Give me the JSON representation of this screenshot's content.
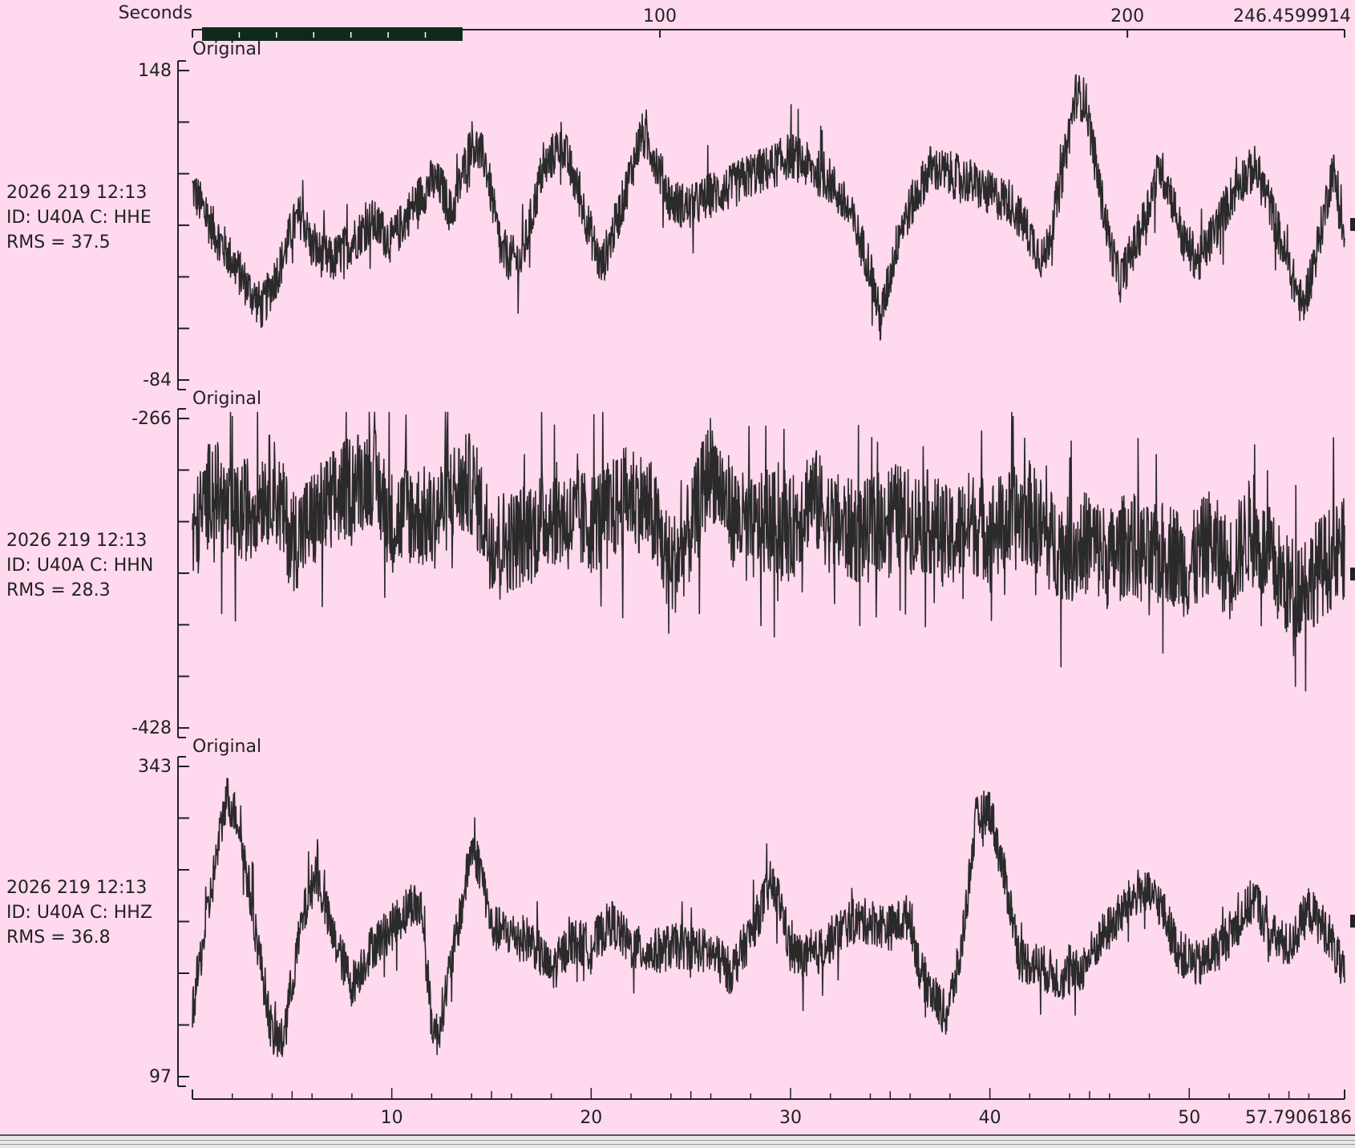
{
  "colors": {
    "background": "#ffd9ee",
    "trace": "#2a2a2a",
    "axis": "#222222",
    "overview_bar": "#0f2a1c",
    "overview_tick": "#ffffff"
  },
  "top_axis": {
    "label": "Seconds",
    "min": 0,
    "max": 246.4599914,
    "max_label": "246.4599914",
    "ticks": [
      {
        "value": 100,
        "label": "100"
      },
      {
        "value": 200,
        "label": "200"
      }
    ],
    "selection": {
      "start": 0,
      "end": 57.7906186
    }
  },
  "bottom_axis": {
    "min": 0,
    "max": 57.7906186,
    "max_label": "57.7906186",
    "ticks": [
      {
        "value": 10,
        "label": "10"
      },
      {
        "value": 20,
        "label": "20"
      },
      {
        "value": 30,
        "label": "30"
      },
      {
        "value": 40,
        "label": "40"
      },
      {
        "value": 50,
        "label": "50"
      }
    ]
  },
  "channels": [
    {
      "tag": "Original",
      "time": "2026 219 12:13",
      "id_line": "ID: U40A C: HHE",
      "rms": "RMS = 37.5",
      "ymax_label": "148",
      "ymin_label": "-84"
    },
    {
      "tag": "Original",
      "time": "2026 219 12:13",
      "id_line": "ID: U40A C: HHN",
      "rms": "RMS = 28.3",
      "ymax_label": "-266",
      "ymin_label": "-428"
    },
    {
      "tag": "Original",
      "time": "2026 219 12:13",
      "id_line": "ID: U40A C: HHZ",
      "rms": "RMS = 36.8",
      "ymax_label": "343",
      "ymin_label": "97"
    }
  ],
  "chart_data": {
    "type": "line",
    "x_unit": "Seconds",
    "x_range": [
      0,
      57.7906186
    ],
    "overview_range": [
      0,
      246.4599914
    ],
    "series": [
      {
        "name": "ID: U40A C: HHE",
        "ylim": [
          -84,
          148
        ],
        "rms": 37.5,
        "envelope": [
          [
            0.0,
            60
          ],
          [
            1.0,
            30
          ],
          [
            2.0,
            5
          ],
          [
            3.0,
            -20
          ],
          [
            3.5,
            -30
          ],
          [
            4.5,
            5
          ],
          [
            5.0,
            30
          ],
          [
            5.5,
            40
          ],
          [
            6.0,
            15
          ],
          [
            7.0,
            5
          ],
          [
            8.0,
            20
          ],
          [
            9.0,
            35
          ],
          [
            10.0,
            20
          ],
          [
            11.0,
            45
          ],
          [
            12.0,
            65
          ],
          [
            12.5,
            60
          ],
          [
            13.0,
            40
          ],
          [
            14.0,
            95
          ],
          [
            14.7,
            80
          ],
          [
            15.5,
            10
          ],
          [
            16.5,
            5
          ],
          [
            17.5,
            70
          ],
          [
            18.5,
            95
          ],
          [
            19.5,
            50
          ],
          [
            20.5,
            0
          ],
          [
            21.5,
            45
          ],
          [
            22.5,
            100
          ],
          [
            23.0,
            90
          ],
          [
            24.0,
            50
          ],
          [
            25.0,
            45
          ],
          [
            26.0,
            55
          ],
          [
            27.0,
            60
          ],
          [
            28.0,
            70
          ],
          [
            29.0,
            75
          ],
          [
            30.0,
            85
          ],
          [
            31.0,
            75
          ],
          [
            32.0,
            65
          ],
          [
            33.0,
            40
          ],
          [
            34.0,
            0
          ],
          [
            34.5,
            -40
          ],
          [
            35.5,
            30
          ],
          [
            37.0,
            75
          ],
          [
            38.0,
            70
          ],
          [
            39.0,
            65
          ],
          [
            40.0,
            55
          ],
          [
            41.0,
            50
          ],
          [
            42.0,
            25
          ],
          [
            42.7,
            5
          ],
          [
            43.5,
            60
          ],
          [
            44.3,
            130
          ],
          [
            44.8,
            125
          ],
          [
            45.5,
            60
          ],
          [
            46.0,
            20
          ],
          [
            46.5,
            -10
          ],
          [
            47.5,
            25
          ],
          [
            48.5,
            75
          ],
          [
            49.0,
            60
          ],
          [
            49.7,
            20
          ],
          [
            50.5,
            5
          ],
          [
            51.5,
            35
          ],
          [
            52.5,
            65
          ],
          [
            53.3,
            75
          ],
          [
            54.0,
            50
          ],
          [
            55.0,
            0
          ],
          [
            55.7,
            -30
          ],
          [
            56.5,
            20
          ],
          [
            57.2,
            75
          ],
          [
            57.79,
            20
          ]
        ]
      },
      {
        "name": "ID: U40A C: HHN",
        "ylim": [
          -428,
          -266
        ],
        "rms": 28.3,
        "envelope": [
          [
            0.0,
            -330
          ],
          [
            1.0,
            -300
          ],
          [
            2.0,
            -320
          ],
          [
            3.0,
            -310
          ],
          [
            4.0,
            -300
          ],
          [
            5.0,
            -330
          ],
          [
            6.0,
            -320
          ],
          [
            7.0,
            -310
          ],
          [
            8.0,
            -300
          ],
          [
            9.0,
            -295
          ],
          [
            10.0,
            -320
          ],
          [
            11.0,
            -315
          ],
          [
            12.0,
            -320
          ],
          [
            13.0,
            -305
          ],
          [
            14.0,
            -300
          ],
          [
            15.0,
            -330
          ],
          [
            16.0,
            -330
          ],
          [
            17.0,
            -325
          ],
          [
            18.0,
            -315
          ],
          [
            19.0,
            -320
          ],
          [
            20.0,
            -320
          ],
          [
            21.0,
            -315
          ],
          [
            22.0,
            -305
          ],
          [
            23.0,
            -315
          ],
          [
            24.0,
            -345
          ],
          [
            25.0,
            -325
          ],
          [
            26.0,
            -290
          ],
          [
            27.0,
            -315
          ],
          [
            28.0,
            -325
          ],
          [
            29.0,
            -320
          ],
          [
            30.0,
            -325
          ],
          [
            31.0,
            -305
          ],
          [
            32.0,
            -320
          ],
          [
            33.0,
            -325
          ],
          [
            34.0,
            -325
          ],
          [
            35.0,
            -315
          ],
          [
            36.0,
            -320
          ],
          [
            37.0,
            -320
          ],
          [
            38.0,
            -330
          ],
          [
            39.0,
            -320
          ],
          [
            40.0,
            -325
          ],
          [
            41.0,
            -320
          ],
          [
            42.0,
            -315
          ],
          [
            43.0,
            -330
          ],
          [
            44.0,
            -335
          ],
          [
            45.0,
            -330
          ],
          [
            46.0,
            -340
          ],
          [
            47.0,
            -330
          ],
          [
            48.0,
            -340
          ],
          [
            49.0,
            -335
          ],
          [
            50.0,
            -345
          ],
          [
            51.0,
            -330
          ],
          [
            52.0,
            -345
          ],
          [
            53.0,
            -325
          ],
          [
            54.0,
            -340
          ],
          [
            55.0,
            -355
          ],
          [
            56.0,
            -350
          ],
          [
            57.0,
            -340
          ],
          [
            57.79,
            -335
          ]
        ]
      },
      {
        "name": "ID: U40A C: HHZ",
        "ylim": [
          97,
          343
        ],
        "rms": 36.8,
        "envelope": [
          [
            0.0,
            150
          ],
          [
            0.8,
            230
          ],
          [
            1.7,
            320
          ],
          [
            2.3,
            300
          ],
          [
            3.0,
            230
          ],
          [
            4.0,
            130
          ],
          [
            4.5,
            125
          ],
          [
            5.5,
            220
          ],
          [
            6.2,
            260
          ],
          [
            7.0,
            210
          ],
          [
            8.0,
            170
          ],
          [
            9.0,
            200
          ],
          [
            10.0,
            215
          ],
          [
            11.0,
            235
          ],
          [
            11.5,
            230
          ],
          [
            12.0,
            140
          ],
          [
            12.3,
            130
          ],
          [
            13.5,
            230
          ],
          [
            14.0,
            280
          ],
          [
            14.5,
            260
          ],
          [
            15.0,
            215
          ],
          [
            16.0,
            210
          ],
          [
            17.0,
            205
          ],
          [
            18.0,
            180
          ],
          [
            19.0,
            205
          ],
          [
            20.0,
            200
          ],
          [
            21.0,
            220
          ],
          [
            22.0,
            200
          ],
          [
            23.0,
            195
          ],
          [
            24.0,
            200
          ],
          [
            25.0,
            200
          ],
          [
            26.0,
            195
          ],
          [
            27.0,
            180
          ],
          [
            28.0,
            210
          ],
          [
            29.0,
            250
          ],
          [
            29.5,
            235
          ],
          [
            30.0,
            195
          ],
          [
            31.0,
            190
          ],
          [
            32.0,
            205
          ],
          [
            33.0,
            220
          ],
          [
            34.0,
            220
          ],
          [
            35.0,
            215
          ],
          [
            36.0,
            225
          ],
          [
            36.5,
            180
          ],
          [
            37.8,
            145
          ],
          [
            38.5,
            190
          ],
          [
            39.3,
            300
          ],
          [
            40.0,
            310
          ],
          [
            41.0,
            235
          ],
          [
            41.5,
            190
          ],
          [
            42.5,
            185
          ],
          [
            43.5,
            175
          ],
          [
            44.5,
            180
          ],
          [
            45.5,
            205
          ],
          [
            46.5,
            225
          ],
          [
            47.5,
            245
          ],
          [
            48.5,
            235
          ],
          [
            49.5,
            195
          ],
          [
            50.5,
            185
          ],
          [
            51.5,
            200
          ],
          [
            52.5,
            220
          ],
          [
            53.3,
            240
          ],
          [
            54.0,
            210
          ],
          [
            55.0,
            200
          ],
          [
            56.0,
            230
          ],
          [
            57.0,
            210
          ],
          [
            57.79,
            175
          ]
        ]
      }
    ]
  }
}
